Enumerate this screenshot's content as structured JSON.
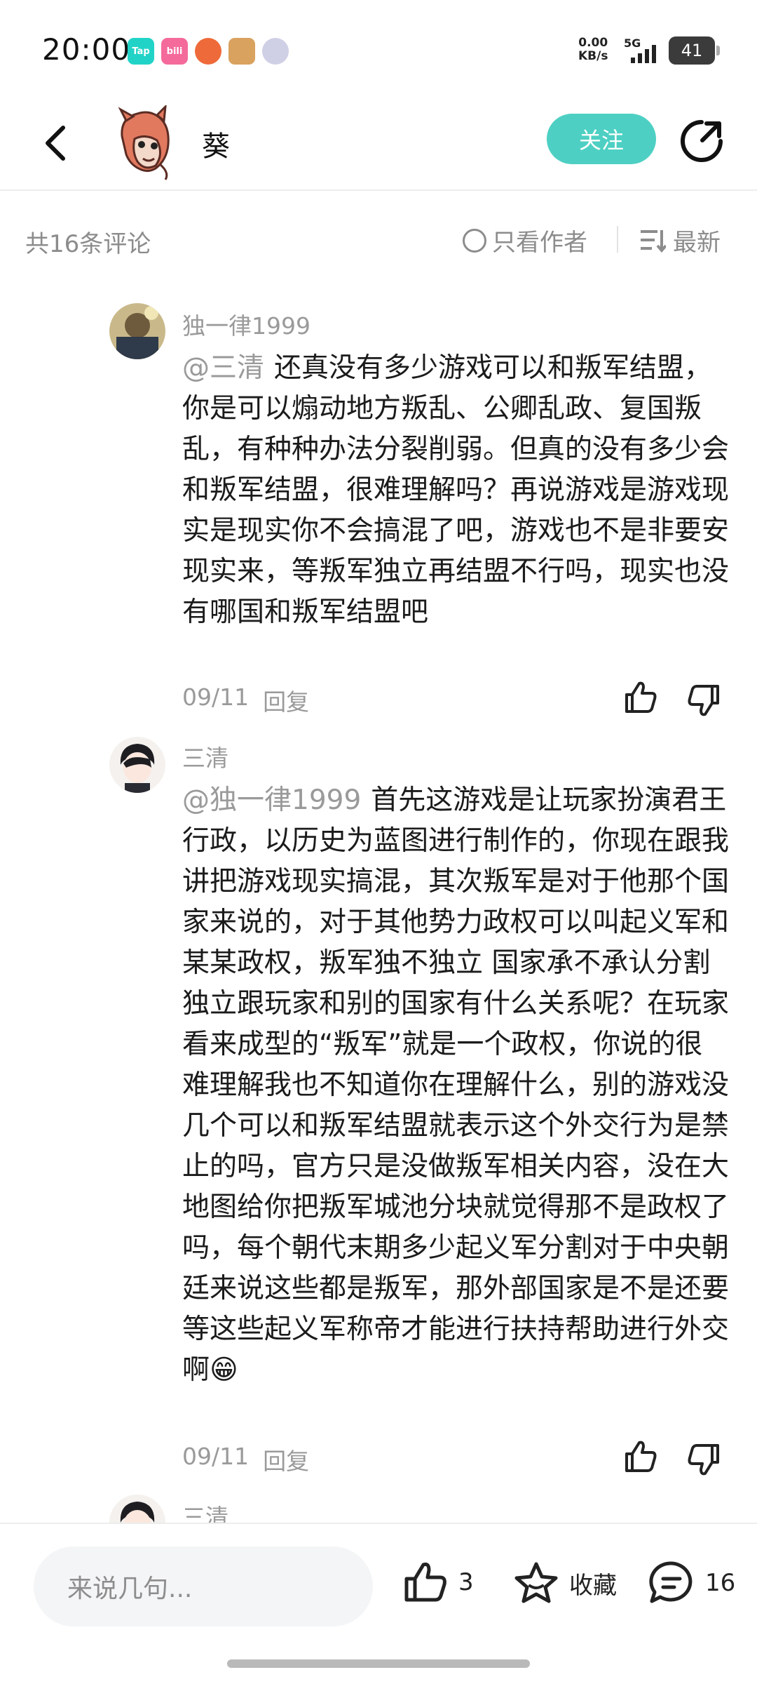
{
  "status_bar": {
    "time": "20:00",
    "apps": [
      {
        "label": "Tap",
        "color": "#21d3c7"
      },
      {
        "label": "bili",
        "color": "#f46a9b"
      },
      {
        "label": "",
        "color": "#ef6a3a"
      },
      {
        "label": "",
        "color": "#d9a25f"
      },
      {
        "label": "",
        "color": "#cfcfe6"
      }
    ],
    "net_speed_value": "0.00",
    "net_speed_unit": "KB/s",
    "network": "5G",
    "battery": "41"
  },
  "header": {
    "author_name": "葵",
    "follow_label": "关注"
  },
  "toolbar": {
    "count_label": "共16条评论",
    "only_author_label": "只看作者",
    "sort_label": "最新"
  },
  "comments": [
    {
      "user": "独一律1999",
      "mention": "@三清",
      "text": "还真没有多少游戏可以和叛军结盟，你是可以煽动地方叛乱、公卿乱政、复国叛乱，有种种办法分裂削弱。但真的没有多少会和叛军结盟，很难理解吗？再说游戏是游戏现实是现实你不会搞混了吧，游戏也不是非要安现实来，等叛军独立再结盟不行吗，现实也没有哪国和叛军结盟吧",
      "date": "09/11",
      "reply_label": "回复"
    },
    {
      "user": "三清",
      "mention": "@独一律1999",
      "text": "首先这游戏是让玩家扮演君王行政，以历史为蓝图进行制作的，你现在跟我讲把游戏现实搞混，其次叛军是对于他那个国家来说的，对于其他势力政权可以叫起义军和某某政权，叛军独不独立  国家承不承认分割独立跟玩家和别的国家有什么关系呢？在玩家看来成型的“叛军”就是一个政权，你说的很难理解我也不知道你在理解什么，别的游戏没几个可以和叛军结盟就表示这个外交行为是禁止的吗，官方只是没做叛军相关内容，没在大地图给你把叛军城池分块就觉得那不是政权了吗，每个朝代末期多少起义军分割对于中央朝廷来说这些都是叛军，那外部国家是不是还要等这些起义军称帝才能进行扶持帮助进行外交啊😁",
      "date": "09/11",
      "reply_label": "回复"
    },
    {
      "user": "三清"
    }
  ],
  "bottom_bar": {
    "input_placeholder": "来说几句...",
    "like_count": "3",
    "favorite_label": "收藏",
    "comment_count": "16"
  },
  "colors": {
    "accent": "#4dd0c3",
    "muted_text": "#9a9a9a"
  }
}
